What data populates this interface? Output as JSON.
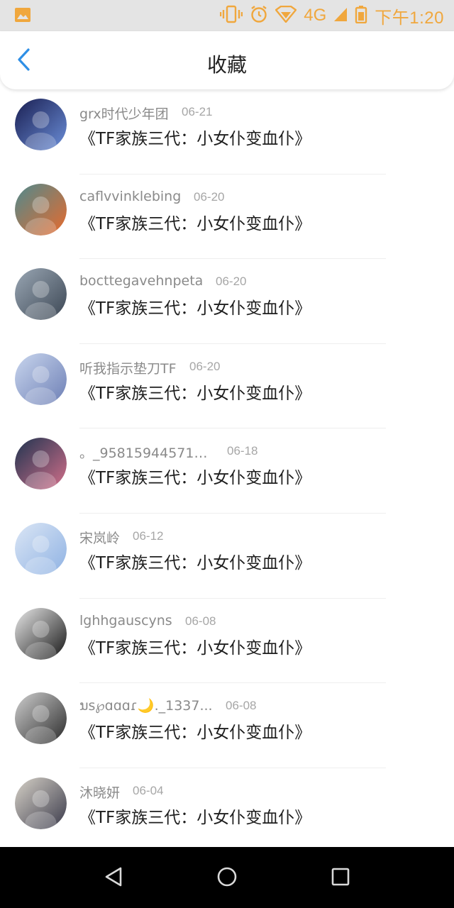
{
  "status_bar": {
    "time": "下午1:20",
    "network": "4G",
    "accent_color": "#f0a73d",
    "icons": [
      "photo-icon",
      "vibrate-icon",
      "alarm-icon",
      "wifi-icon",
      "signal-icon",
      "battery-icon"
    ]
  },
  "header": {
    "title": "收藏",
    "back_icon": "chevron-left-icon",
    "accent_color": "#2f8fe6"
  },
  "favorites": [
    {
      "username": "grx时代少年团",
      "date": "06-21",
      "title": "《TF家族三代：小女仆变血仆》",
      "avatar_colors": [
        "#1a1f52",
        "#6b8ed8"
      ]
    },
    {
      "username": "caflvvinklebing",
      "date": "06-20",
      "title": "《TF家族三代：小女仆变血仆》",
      "avatar_colors": [
        "#4f8a8e",
        "#e86a2c"
      ]
    },
    {
      "username": "bocttegavehnpeta",
      "date": "06-20",
      "title": "《TF家族三代：小女仆变血仆》",
      "avatar_colors": [
        "#9aa7b4",
        "#3b4653"
      ]
    },
    {
      "username": "听我指示垫刀TF",
      "date": "06-20",
      "title": "《TF家族三代：小女仆变血仆》",
      "avatar_colors": [
        "#c9d6ee",
        "#6d7fb5"
      ]
    },
    {
      "username": "。_958159445719...",
      "date": "06-18",
      "title": "《TF家族三代：小女仆变血仆》",
      "avatar_colors": [
        "#1f3450",
        "#d36f8a"
      ]
    },
    {
      "username": "宋岚岭",
      "date": "06-12",
      "title": "《TF家族三代：小女仆变血仆》",
      "avatar_colors": [
        "#dbe6f5",
        "#8fb2e3"
      ]
    },
    {
      "username": "lghhgauscyns",
      "date": "06-08",
      "title": "《TF家族三代：小女仆变血仆》",
      "avatar_colors": [
        "#e9e9e9",
        "#151515"
      ]
    },
    {
      "username": "ນs℘ɑɑɑɾ🌙._1337...",
      "date": "06-08",
      "title": "《TF家族三代：小女仆变血仆》",
      "avatar_colors": [
        "#cfcfcf",
        "#2a2a2a"
      ]
    },
    {
      "username": "沐晓妍",
      "date": "06-04",
      "title": "《TF家族三代：小女仆变血仆》",
      "avatar_colors": [
        "#d7d2c8",
        "#3a3a4a"
      ]
    }
  ],
  "nav_bar": {
    "back_icon": "triangle-back-icon",
    "home_icon": "circle-home-icon",
    "recents_icon": "square-recents-icon"
  }
}
